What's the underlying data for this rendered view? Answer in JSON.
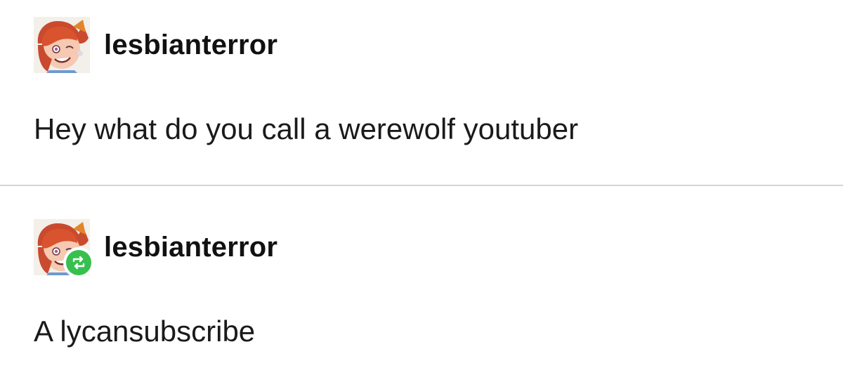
{
  "posts": [
    {
      "username": "lesbianterror",
      "body": "Hey what do you call a werewolf youtuber",
      "avatar_icon": "user-avatar-icon",
      "reblogged": false
    },
    {
      "username": "lesbianterror",
      "body": "A lycansubscribe",
      "avatar_icon": "user-avatar-icon",
      "reblogged": true,
      "badge_icon": "reblog-icon"
    }
  ],
  "colors": {
    "reblog_badge": "#37c04e",
    "divider": "#d4d4d4",
    "text": "#111111"
  }
}
